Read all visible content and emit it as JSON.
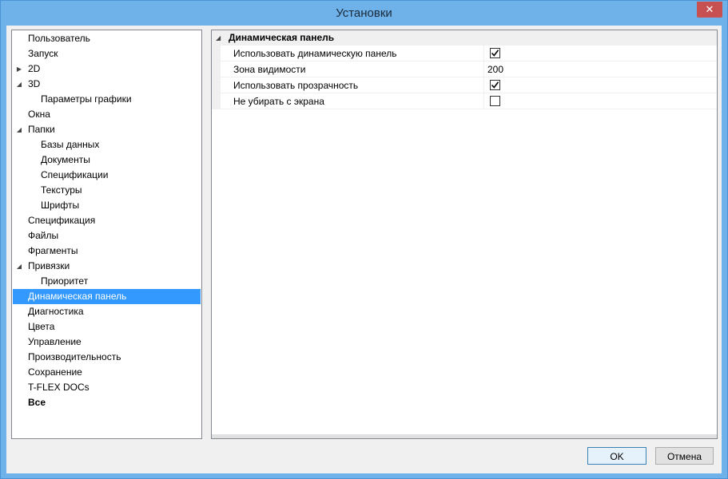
{
  "window": {
    "title": "Установки",
    "close_glyph": "✕"
  },
  "tree": {
    "items": [
      {
        "label": "Пользователь",
        "level": 0,
        "expander": "",
        "selected": false,
        "bold": false
      },
      {
        "label": "Запуск",
        "level": 0,
        "expander": "",
        "selected": false,
        "bold": false
      },
      {
        "label": "2D",
        "level": 0,
        "expander": "▶",
        "selected": false,
        "bold": false
      },
      {
        "label": "3D",
        "level": 0,
        "expander": "◢",
        "selected": false,
        "bold": false
      },
      {
        "label": "Параметры графики",
        "level": 1,
        "expander": "",
        "selected": false,
        "bold": false
      },
      {
        "label": "Окна",
        "level": 0,
        "expander": "",
        "selected": false,
        "bold": false
      },
      {
        "label": "Папки",
        "level": 0,
        "expander": "◢",
        "selected": false,
        "bold": false
      },
      {
        "label": "Базы данных",
        "level": 1,
        "expander": "",
        "selected": false,
        "bold": false
      },
      {
        "label": "Документы",
        "level": 1,
        "expander": "",
        "selected": false,
        "bold": false
      },
      {
        "label": "Спецификации",
        "level": 1,
        "expander": "",
        "selected": false,
        "bold": false
      },
      {
        "label": "Текстуры",
        "level": 1,
        "expander": "",
        "selected": false,
        "bold": false
      },
      {
        "label": "Шрифты",
        "level": 1,
        "expander": "",
        "selected": false,
        "bold": false
      },
      {
        "label": "Спецификация",
        "level": 0,
        "expander": "",
        "selected": false,
        "bold": false
      },
      {
        "label": "Файлы",
        "level": 0,
        "expander": "",
        "selected": false,
        "bold": false
      },
      {
        "label": "Фрагменты",
        "level": 0,
        "expander": "",
        "selected": false,
        "bold": false
      },
      {
        "label": "Привязки",
        "level": 0,
        "expander": "◢",
        "selected": false,
        "bold": false
      },
      {
        "label": "Приоритет",
        "level": 1,
        "expander": "",
        "selected": false,
        "bold": false
      },
      {
        "label": "Динамическая панель",
        "level": 0,
        "expander": "",
        "selected": true,
        "bold": false
      },
      {
        "label": "Диагностика",
        "level": 0,
        "expander": "",
        "selected": false,
        "bold": false
      },
      {
        "label": "Цвета",
        "level": 0,
        "expander": "",
        "selected": false,
        "bold": false
      },
      {
        "label": "Управление",
        "level": 0,
        "expander": "",
        "selected": false,
        "bold": false
      },
      {
        "label": "Производительность",
        "level": 0,
        "expander": "",
        "selected": false,
        "bold": false
      },
      {
        "label": "Сохранение",
        "level": 0,
        "expander": "",
        "selected": false,
        "bold": false
      },
      {
        "label": "T-FLEX DOCs",
        "level": 0,
        "expander": "",
        "selected": false,
        "bold": false
      },
      {
        "label": "Все",
        "level": 0,
        "expander": "",
        "selected": false,
        "bold": true
      }
    ]
  },
  "properties": {
    "category": {
      "label": "Динамическая панель",
      "expander": "◢"
    },
    "rows": [
      {
        "name": "Использовать динамическую панель",
        "type": "checkbox",
        "checked": true
      },
      {
        "name": "Зона видимости",
        "type": "text",
        "value": "200"
      },
      {
        "name": "Использовать прозрачность",
        "type": "checkbox",
        "checked": true
      },
      {
        "name": "Не убирать с экрана",
        "type": "checkbox",
        "checked": false
      }
    ]
  },
  "buttons": {
    "ok": "OK",
    "cancel": "Отмена"
  },
  "colors": {
    "selection": "#3399ff",
    "title_bar": "#6fb2ea",
    "close_button": "#c75050"
  }
}
